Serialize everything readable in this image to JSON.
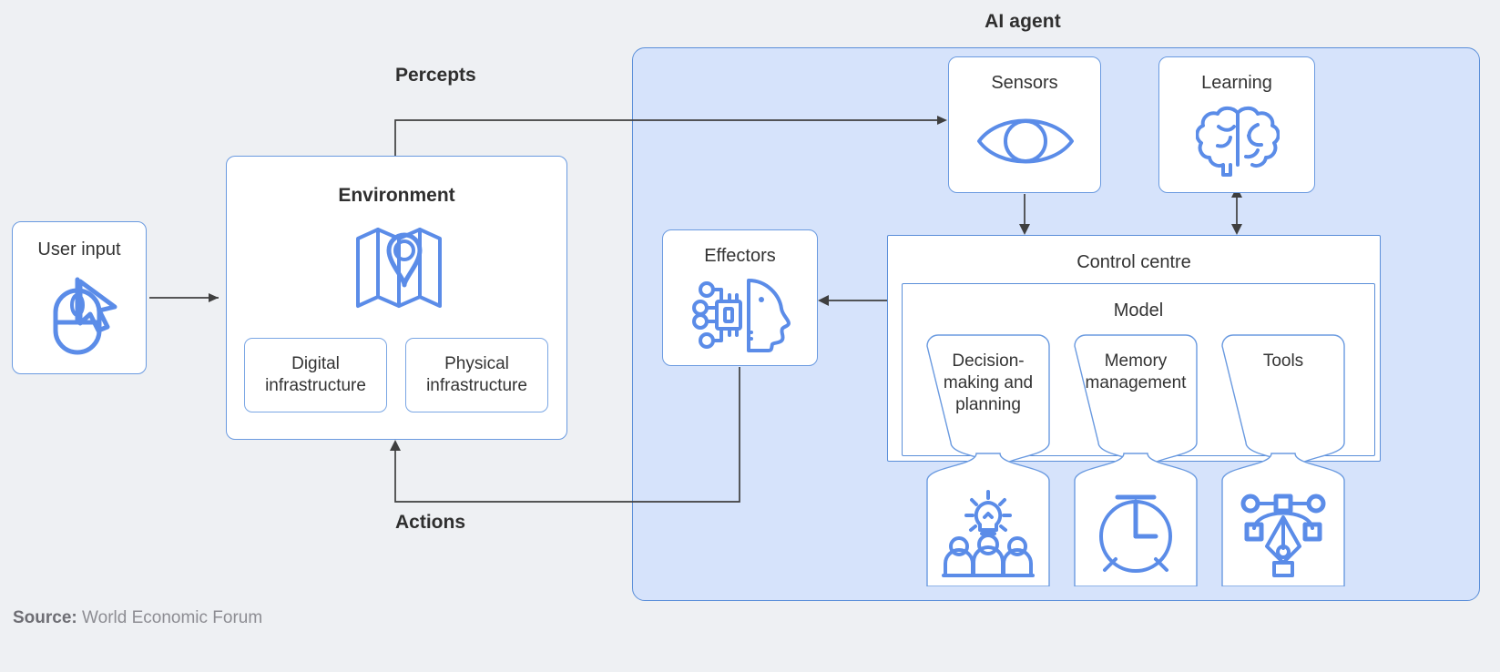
{
  "diagram": {
    "title": "AI agent",
    "flow_labels": {
      "percepts": "Percepts",
      "actions": "Actions"
    },
    "source": {
      "prefix": "Source:",
      "name": "World Economic Forum"
    },
    "colors": {
      "background": "#eef0f3",
      "panel_fill": "#d6e3fb",
      "panel_border": "#5b8fd9",
      "card_fill": "#ffffff",
      "card_border": "#6a9ae0",
      "icon_blue": "#5b8ce8",
      "text": "#333333",
      "connector": "#3f3f3f",
      "source_text": "#8d8d93"
    }
  },
  "user_input": {
    "label": "User input",
    "icon": "mouse-cursor-icon"
  },
  "environment": {
    "label": "Environment",
    "icon": "map-pin-icon",
    "sub_boxes": [
      {
        "label": "Digital infrastructure"
      },
      {
        "label": "Physical infrastructure"
      }
    ]
  },
  "agent": {
    "sensors": {
      "label": "Sensors",
      "icon": "eye-icon"
    },
    "learning": {
      "label": "Learning",
      "icon": "brain-icon"
    },
    "effectors": {
      "label": "Effectors",
      "icon": "ai-head-chip-icon"
    },
    "control_centre": {
      "label": "Control centre"
    },
    "model": {
      "label": "Model",
      "components": [
        {
          "label": "Decision-making and planning",
          "icon": "lightbulb-people-icon"
        },
        {
          "label": "Memory management",
          "icon": "alarm-clock-icon"
        },
        {
          "label": "Tools",
          "icon": "pen-nib-nodes-icon"
        }
      ]
    }
  }
}
